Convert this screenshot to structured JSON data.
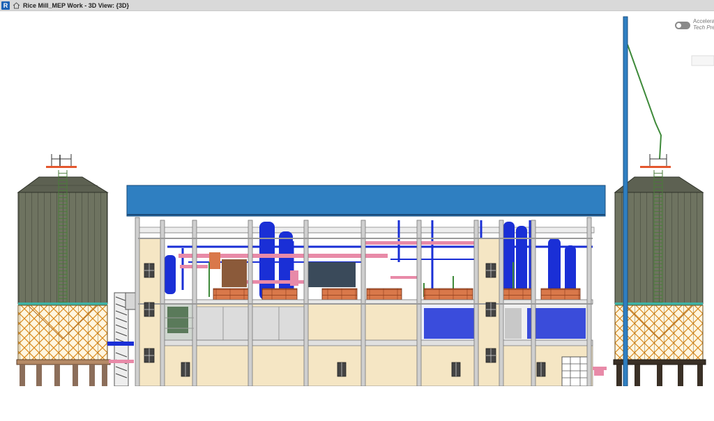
{
  "window": {
    "app_icon_letter": "R",
    "title": "Rice Mill_MEP Work - 3D View: {3D}"
  },
  "overlay": {
    "accelerated_label": "Accelerated",
    "tech_preview_label": "Tech Preview"
  },
  "icons": {
    "app": "revit-app-icon",
    "home": "home-icon",
    "toggle": "toggle-switch-icon"
  },
  "colors": {
    "roof": "#2f7fc1",
    "silo_body": "#6e7360",
    "silo_cone": "#e0a53a",
    "wall_fill": "#f5e6c4",
    "equipment_blue": "#1a2fd6",
    "equipment_pink": "#e88aa8",
    "equipment_orange": "#d9784a",
    "steel_frame": "#c9c9c9"
  }
}
